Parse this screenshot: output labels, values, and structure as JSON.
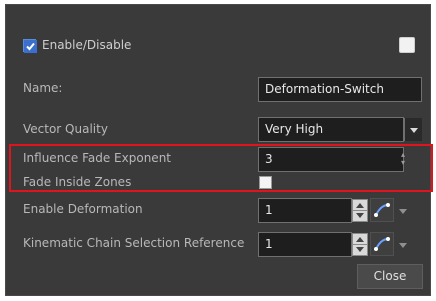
{
  "dialog": {
    "enable_label": "Enable/Disable",
    "enable_checked": true,
    "name_label": "Name:",
    "name_value": "Deformation-Switch",
    "vector_quality_label": "Vector Quality",
    "vector_quality_value": "Very High",
    "influence_label": "Influence Fade Exponent",
    "influence_value": "3",
    "fade_inside_label": "Fade Inside Zones",
    "fade_inside_checked": false,
    "enable_deformation_label": "Enable Deformation",
    "enable_deformation_value": "1",
    "kinematic_label": "Kinematic Chain Selection Reference",
    "kinematic_value": "1",
    "close_label": "Close"
  },
  "icons": {
    "link": "link-curve-icon",
    "dropdown": "chevron-down-icon",
    "spin": "spin-arrows-icon"
  },
  "colors": {
    "highlight": "#e0141c",
    "panel": "#3a3a3a",
    "field": "#1e1e1e",
    "link_accent": "#6aa0ff"
  }
}
